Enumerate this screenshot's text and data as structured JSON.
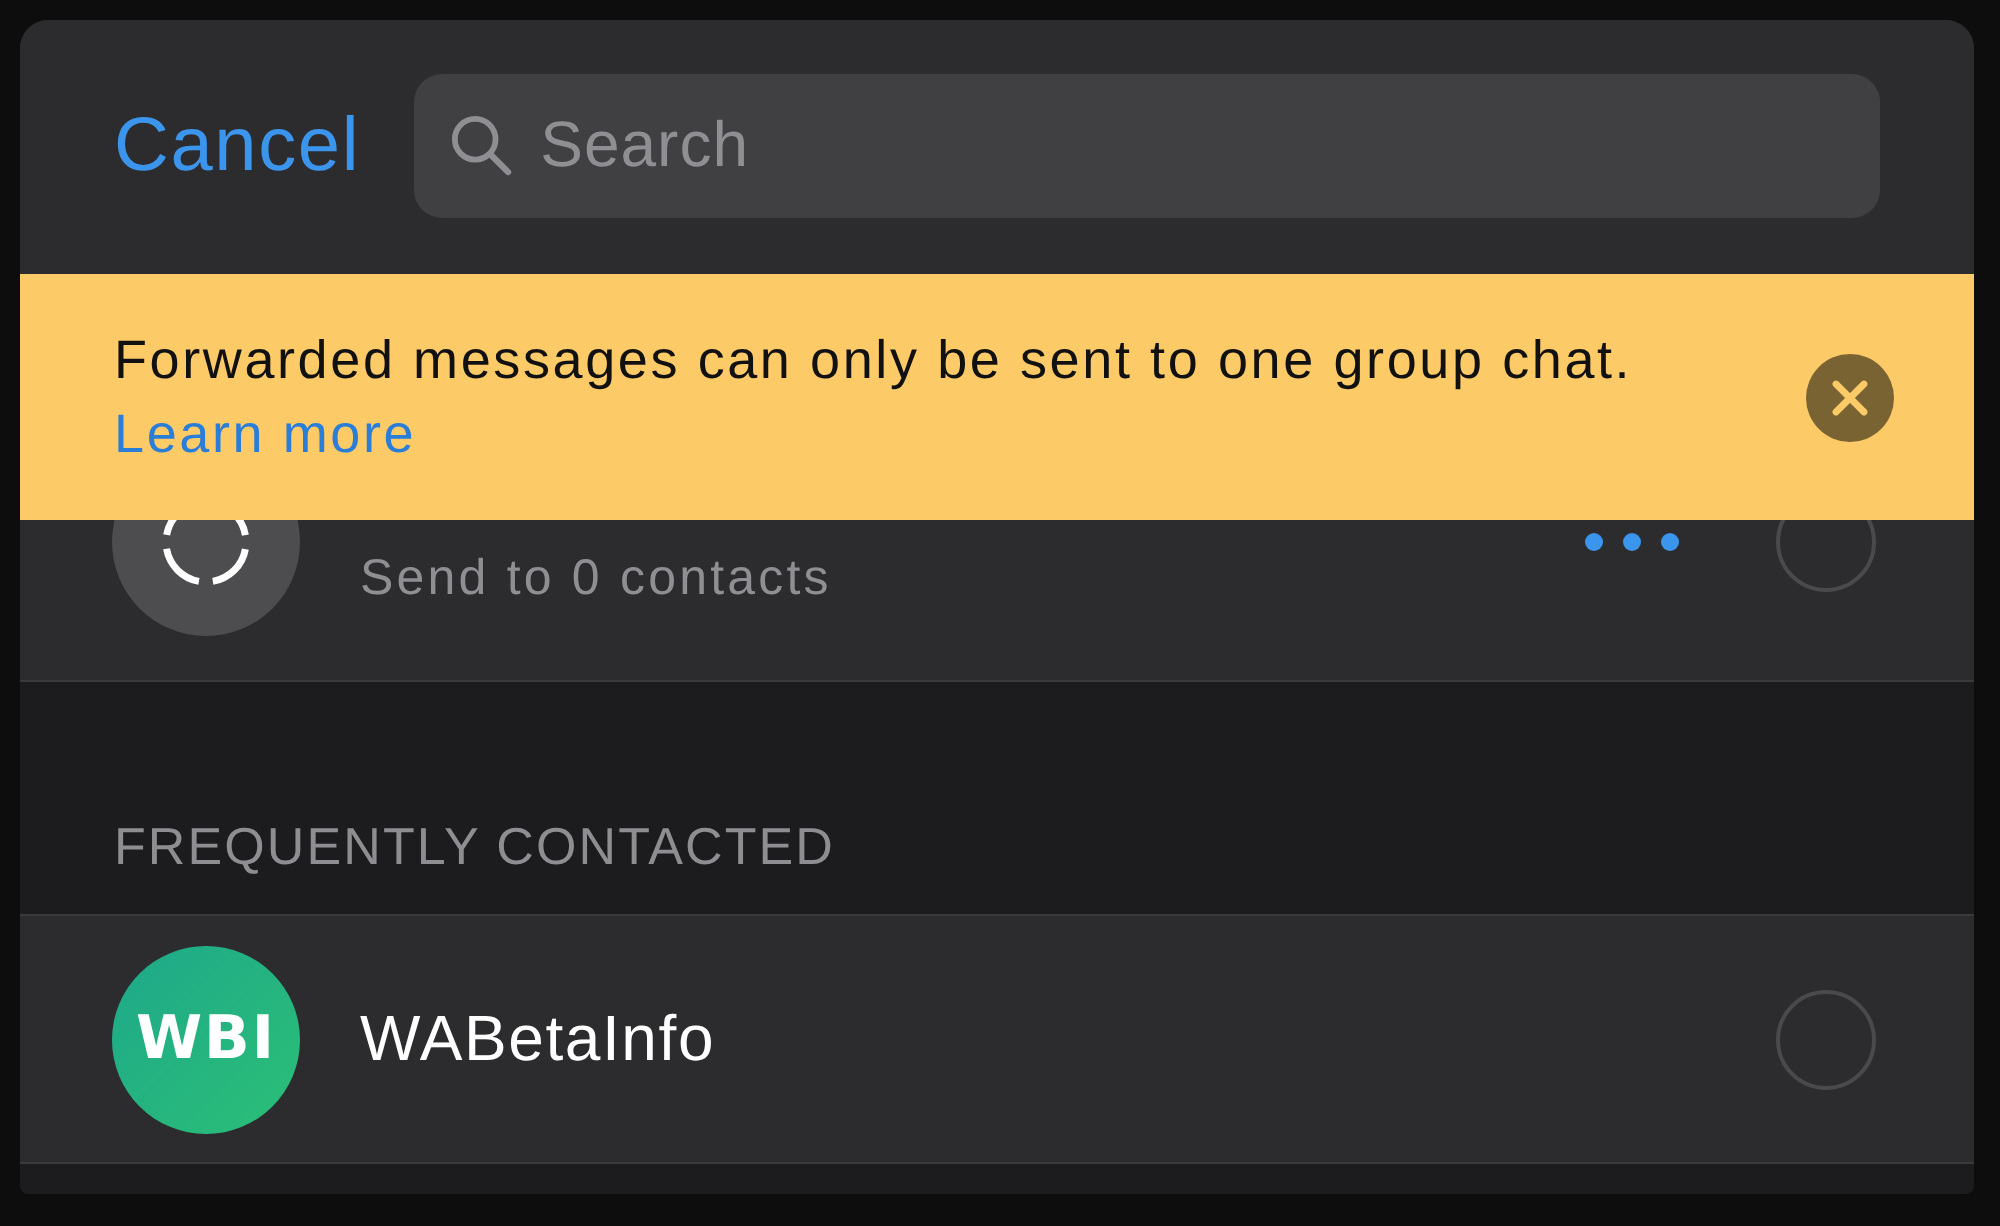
{
  "header": {
    "cancel": "Cancel",
    "search": {
      "placeholder": "Search"
    }
  },
  "banner": {
    "message": "Forwarded messages can only be sent to one group chat.",
    "link": "Learn more"
  },
  "status": {
    "subtitle": "Send to 0 contacts",
    "selected": false
  },
  "sections": [
    {
      "title": "FREQUENTLY CONTACTED",
      "contacts": [
        {
          "name": "WABetaInfo",
          "avatar": "WBI",
          "selected": false
        }
      ]
    }
  ]
}
